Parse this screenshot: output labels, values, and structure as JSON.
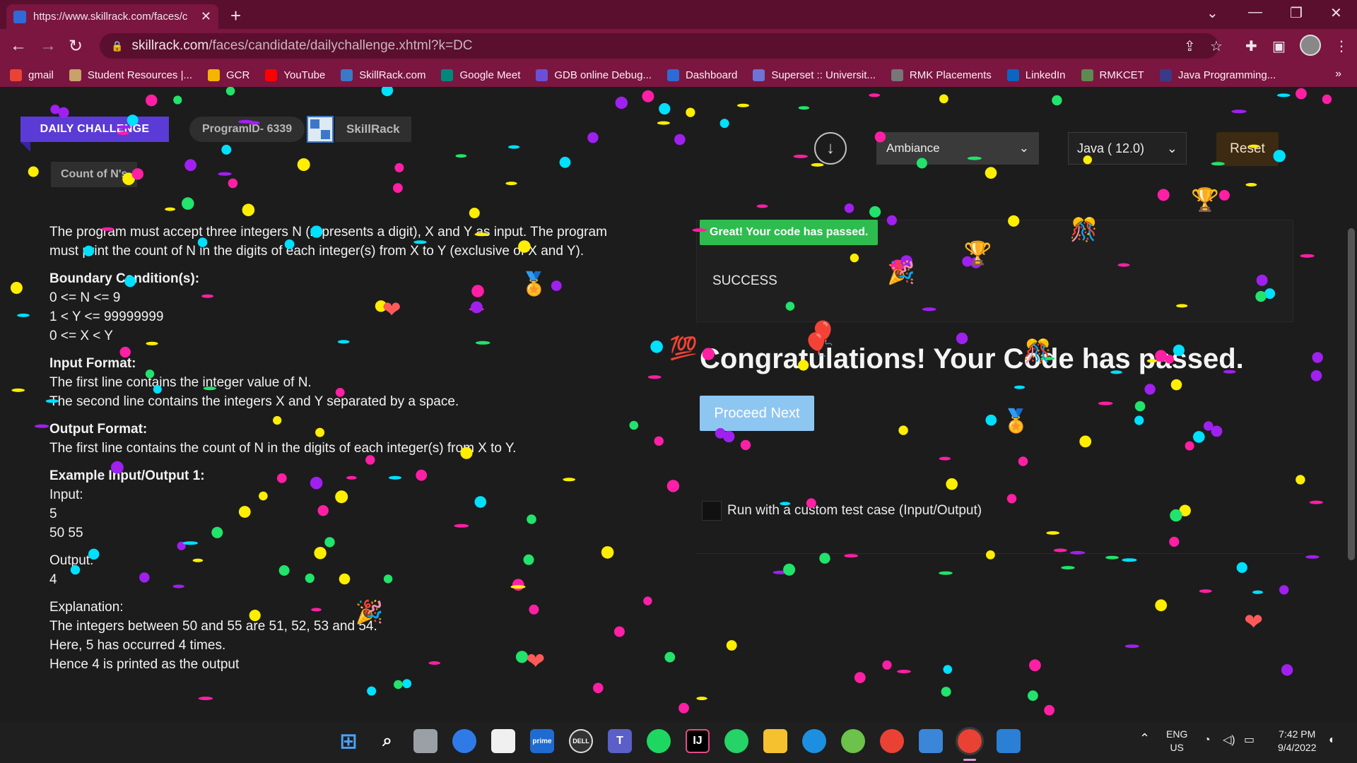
{
  "browser": {
    "tab_title": "https://www.skillrack.com/faces/c",
    "tab_close": "✕",
    "new_tab": "+",
    "url_domain": "skillrack.com",
    "url_path": "/faces/candidate/dailychallenge.xhtml?k=DC",
    "bookmarks": [
      {
        "label": "gmail",
        "color": "#ea4335"
      },
      {
        "label": "Student Resources |...",
        "color": "#c7a36a"
      },
      {
        "label": "GCR",
        "color": "#f4b400"
      },
      {
        "label": "YouTube",
        "color": "#ff0000"
      },
      {
        "label": "SkillRack.com",
        "color": "#3b78c8"
      },
      {
        "label": "Google Meet",
        "color": "#00897b"
      },
      {
        "label": "GDB online Debug...",
        "color": "#6c4fd8"
      },
      {
        "label": "Dashboard",
        "color": "#2f6bd6"
      },
      {
        "label": "Superset :: Universit...",
        "color": "#6f72d6"
      },
      {
        "label": "RMK Placements",
        "color": "#777777"
      },
      {
        "label": "LinkedIn",
        "color": "#0a66c2"
      },
      {
        "label": "RMKCET",
        "color": "#5d8a4f"
      },
      {
        "label": "Java Programming...",
        "color": "#3a3a8a"
      }
    ],
    "bookmarks_more": "»"
  },
  "header": {
    "daily_challenge": "DAILY CHALLENGE",
    "program_id": "ProgramID- 6339",
    "brand": "SkillRack",
    "count_title": "Count of N's"
  },
  "problem": {
    "intro_1": "The program must accept three integers N (represents a digit), X and Y as input. The program",
    "intro_2": "must print the count of N in the digits of each integer(s) from X to Y (exclusive of X and Y).",
    "boundary_heading": "Boundary Condition(s):",
    "boundary": [
      "0 <= N <= 9",
      "1 < Y <= 99999999",
      "0 <= X < Y"
    ],
    "input_heading": "Input Format:",
    "input_lines": [
      "The first line contains the integer value of N.",
      "The second line contains the integers X and Y separated by a space."
    ],
    "output_heading": "Output Format:",
    "output_line": "The first line contains the count of N in the digits of each integer(s) from X to Y.",
    "example_heading": "Example Input/Output 1:",
    "input_label": "Input:",
    "input_values": [
      "5",
      "50 55"
    ],
    "output_label": "Output:",
    "output_value": "4",
    "explanation_label": "Explanation:",
    "explanation_lines": [
      "The integers between 50 and 55 are 51, 52, 53 and 54.",
      "Here, 5 has occurred 4 times.",
      "Hence 4 is printed as the output"
    ]
  },
  "editor": {
    "theme": "Ambiance",
    "language": "Java ( 12.0)",
    "reset": "Reset"
  },
  "result": {
    "badge": "Great! Your code has passed.",
    "status": "SUCCESS",
    "congrats": "Congratulations! Your Code has passed.",
    "proceed": "Proceed Next",
    "custom_test": "Run with a custom test case (Input/Output)"
  },
  "taskbar": {
    "lang": "ENG",
    "region": "US",
    "time": "7:42 PM",
    "date": "9/4/2022"
  },
  "colors": {
    "tab_bar": "#5a0f2e",
    "toolbar": "#7a1640",
    "daily_challenge": "#5b3bd6",
    "success_green": "#2ebc4f",
    "proceed_blue": "#8ec6f2"
  }
}
